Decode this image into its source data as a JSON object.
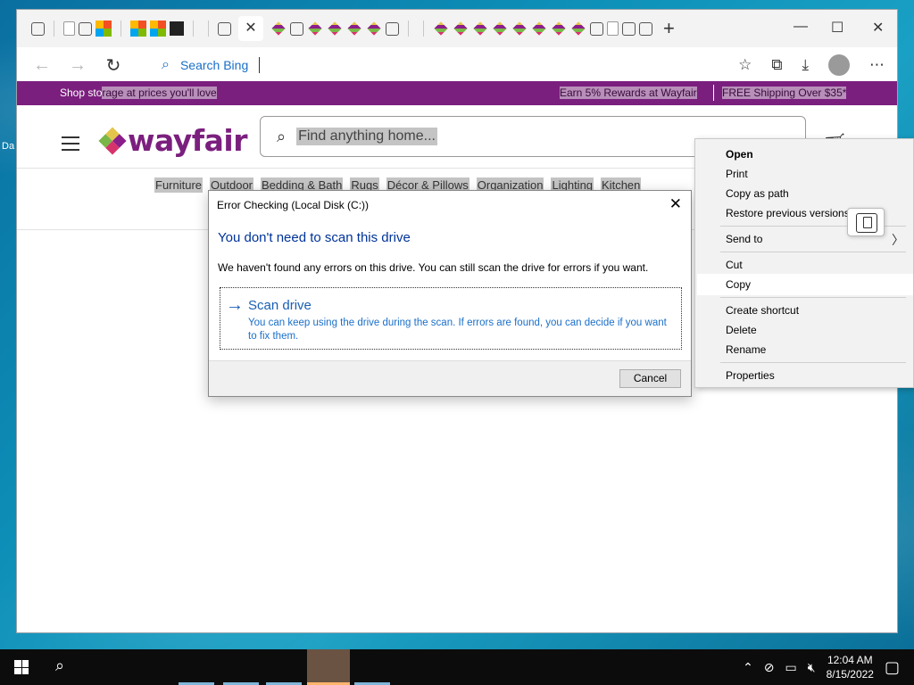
{
  "desktop": {
    "label": "Da"
  },
  "browser": {
    "tabs": {
      "close_glyph": "✕",
      "new_glyph": "+"
    },
    "window_controls": {
      "minimize": "—",
      "maximize": "☐",
      "close": "✕"
    },
    "address": {
      "search_placeholder": "Search Bing"
    }
  },
  "page": {
    "promo": {
      "left_prefix": "Shop sto",
      "left_rest": "rage at prices you'll love",
      "rewards": "Earn 5% Rewards at Wayfair",
      "shipping": "FREE Shipping Over $35*"
    },
    "logo_text": "wayfair",
    "search_placeholder": "Find anything home...",
    "categories": [
      "Furniture",
      "Outdoor",
      "Bedding & Bath",
      "Rugs",
      "Décor & Pillows",
      "Organization",
      "Lighting",
      "Kitchen"
    ]
  },
  "dialog": {
    "title": "Error Checking (Local Disk (C:))",
    "heading": "You don't need to scan this drive",
    "message": "We haven't found any errors on this drive. You can still scan the drive for errors if you want.",
    "scan_label": "Scan drive",
    "scan_desc": "You can keep using the drive during the scan. If errors are found, you can decide if you want to fix them.",
    "cancel": "Cancel"
  },
  "context_menu": {
    "items": [
      "Open",
      "Print",
      "Copy as path",
      "Restore previous versions",
      "Send to",
      "Cut",
      "Copy",
      "Create shortcut",
      "Delete",
      "Rename",
      "Properties"
    ],
    "highlighted": "Copy"
  },
  "taskbar": {
    "time": "12:04 AM",
    "date": "8/15/2022"
  },
  "colors": {
    "brand": "#7b1f7e",
    "link": "#1a5fb4",
    "dialog_heading": "#003399"
  }
}
